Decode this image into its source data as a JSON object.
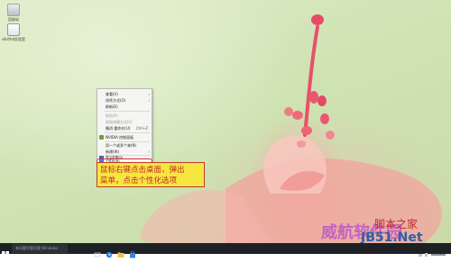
{
  "desktop": {
    "icons": [
      {
        "label": "回收站",
        "color": "#cfd6d8"
      },
      {
        "label": "vikrthd实验室"
      }
    ]
  },
  "context_menu": {
    "items": [
      {
        "label": "查看(V)",
        "submenu": true
      },
      {
        "label": "排序方式(O)",
        "submenu": true
      },
      {
        "label": "刷新(E)"
      },
      {
        "label": "粘贴(P)",
        "disabled": true
      },
      {
        "label": "粘贴快捷方式(S)",
        "disabled": true
      },
      {
        "label": "撤消 重命名(U)",
        "shortcut": "Ctrl+Z"
      },
      {
        "label": "NVIDIA 控制面板"
      },
      {
        "label": "用一个或多个来(N)"
      },
      {
        "label": "新建(W)",
        "submenu": true
      },
      {
        "label": "显示设置(D)"
      },
      {
        "label": "个性化(R)"
      }
    ]
  },
  "callout": {
    "line1": "鼠标右键点击桌面，弹出",
    "line2": "菜单，点击个性化选项"
  },
  "watermark": {
    "brand": "威航软件园",
    "site": "脚本之家",
    "domain": "JB51.Net"
  },
  "taskbar": {
    "search_placeholder": "有问题尽管问我 Windows"
  },
  "colors": {
    "highlight_red": "#d8333d",
    "callout_bg": "#f6e640",
    "callout_text": "#c4282a",
    "taskbar_bg": "#1d2125"
  }
}
